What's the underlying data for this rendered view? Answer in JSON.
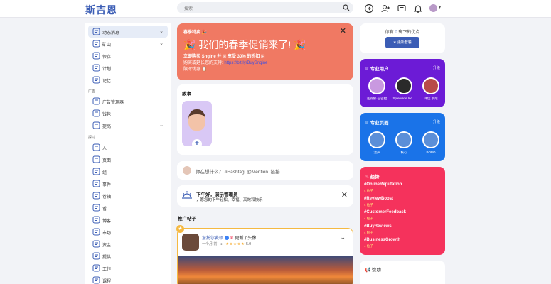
{
  "header": {
    "logo": "斯吉恩",
    "search_placeholder": "搜索"
  },
  "sidebar": {
    "items": [
      {
        "label": "动态消息",
        "icon": "news-feed-icon",
        "active": true,
        "chevron": true
      },
      {
        "label": "矿山",
        "icon": "mine-icon",
        "chevron": true
      },
      {
        "label": "保存",
        "icon": "save-icon"
      },
      {
        "label": "计划",
        "icon": "plan-icon"
      },
      {
        "label": "记忆",
        "icon": "memory-icon"
      }
    ],
    "ads_heading": "广告",
    "ads_items": [
      {
        "label": "广告管理器",
        "icon": "megaphone-icon"
      },
      {
        "label": "钱包",
        "icon": "wallet-icon"
      },
      {
        "label": "提高",
        "icon": "boost-icon",
        "chevron": true
      }
    ],
    "explore_heading": "探讨",
    "explore_items": [
      {
        "label": "人",
        "icon": "people-icon"
      },
      {
        "label": "页面",
        "icon": "pages-icon"
      },
      {
        "label": "组",
        "icon": "groups-icon"
      },
      {
        "label": "事件",
        "icon": "events-icon"
      },
      {
        "label": "卷轴",
        "icon": "reels-icon"
      },
      {
        "label": "看",
        "icon": "watch-icon"
      },
      {
        "label": "博客",
        "icon": "blog-icon"
      },
      {
        "label": "市场",
        "icon": "market-icon"
      },
      {
        "label": "资金",
        "icon": "funding-icon"
      },
      {
        "label": "提供",
        "icon": "offers-icon"
      },
      {
        "label": "工作",
        "icon": "jobs-icon"
      },
      {
        "label": "课程",
        "icon": "courses-icon"
      }
    ]
  },
  "promo": {
    "tag": "春季特卖",
    "title": "我们的春季促销来了!",
    "line1": "立即购买 Sngine 并 🇫 享受 30% 的折扣 🇫",
    "line2_prefix": "购买或延长您的支持:",
    "line2_link": "https://bit.ly/BuySngine",
    "line3": "限时优惠 📋"
  },
  "stories": {
    "title": "故事"
  },
  "composer": {
    "placeholder": "你在想什么？ #Hashtag..@Mention..链接.."
  },
  "greeting": {
    "title": "下午好，演示管理员",
    "subtitle": "，愿您的下午轻松、幸福、高效和快乐"
  },
  "promoted": {
    "heading": "推广帖子"
  },
  "post": {
    "author": "詹托尔麦顿",
    "action": "更新了头像",
    "meta": "一个月 前",
    "rating_value": "5.0"
  },
  "right": {
    "you_have": "你有",
    "remaining_points": "剩下的优点",
    "points_value": "0",
    "points_button": "更新套餐",
    "pro_users_title": "专业用户",
    "upgrade": "升级",
    "pro_users": [
      {
        "name": "连森依·巴巴拉",
        "color": "#c999e0"
      },
      {
        "name": "Splendide Inc...",
        "color": "#2a2a2a"
      },
      {
        "name": "洋佳 多霞",
        "color": "#b84a4a"
      }
    ],
    "pro_pages_title": "专业页面",
    "pro_pages": [
      {
        "name": "温声"
      },
      {
        "name": "核心"
      },
      {
        "name": "BOBO"
      }
    ],
    "trends_title": "趋势",
    "trends": [
      {
        "tag": "#OnlineReputation",
        "count": "4 帖子"
      },
      {
        "tag": "#ReviewBoost",
        "count": "4 帖子"
      },
      {
        "tag": "#CustomerFeedback",
        "count": "4 帖子"
      },
      {
        "tag": "#BuyReviews",
        "count": "4 帖子"
      },
      {
        "tag": "#BusinessGrowth",
        "count": "4 帖子"
      }
    ],
    "sponsored_title": "赞助"
  },
  "colors": {
    "brand": "#3b5db5",
    "promo": "#f07963",
    "pro_users_bg": "#6c1bd6",
    "pro_pages_bg": "#1a73e8",
    "trends_bg": "#f5325c"
  }
}
